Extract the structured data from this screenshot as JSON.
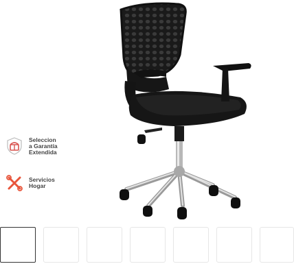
{
  "product": {
    "image_alt": "Black mesh office chair with armrests and chrome star base"
  },
  "services": [
    {
      "label": "Seleccion\na Garantía\nExtendida",
      "icon": "shield-warranty-icon",
      "color": "#d9534f"
    },
    {
      "label": "Servicios\nHogar",
      "icon": "tools-icon",
      "color": "#e8553b"
    }
  ],
  "thumbnails": {
    "count": 7,
    "selected_index": 0
  }
}
